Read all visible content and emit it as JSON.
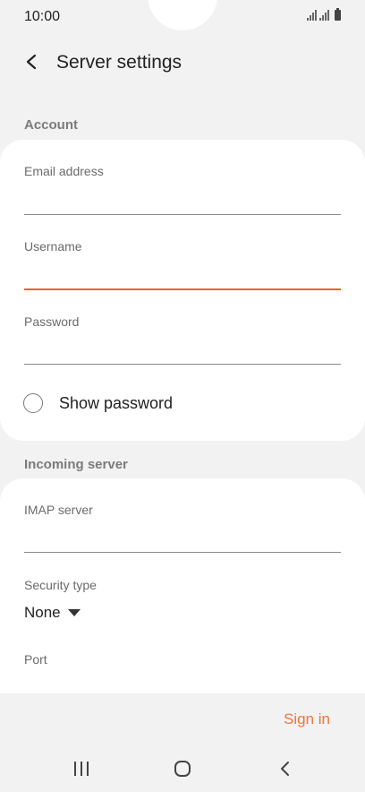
{
  "status_bar": {
    "time": "10:00"
  },
  "header": {
    "title": "Server settings"
  },
  "account": {
    "section_label": "Account",
    "email_label": "Email address",
    "email_value": "",
    "username_label": "Username",
    "username_value": "",
    "password_label": "Password",
    "password_value": "",
    "show_password_label": "Show password"
  },
  "incoming": {
    "section_label": "Incoming server",
    "imap_label": "IMAP server",
    "imap_value": "",
    "security_label": "Security type",
    "security_value": "None",
    "port_label": "Port"
  },
  "footer": {
    "sign_in_label": "Sign in"
  },
  "colors": {
    "accent": "#f2743b",
    "active_underline": "#f0602a",
    "background": "#f2f2f2"
  },
  "icons": {
    "back": "chevron-left-icon",
    "recents": "recent-apps-icon",
    "home": "home-icon",
    "nav_back": "back-icon"
  }
}
